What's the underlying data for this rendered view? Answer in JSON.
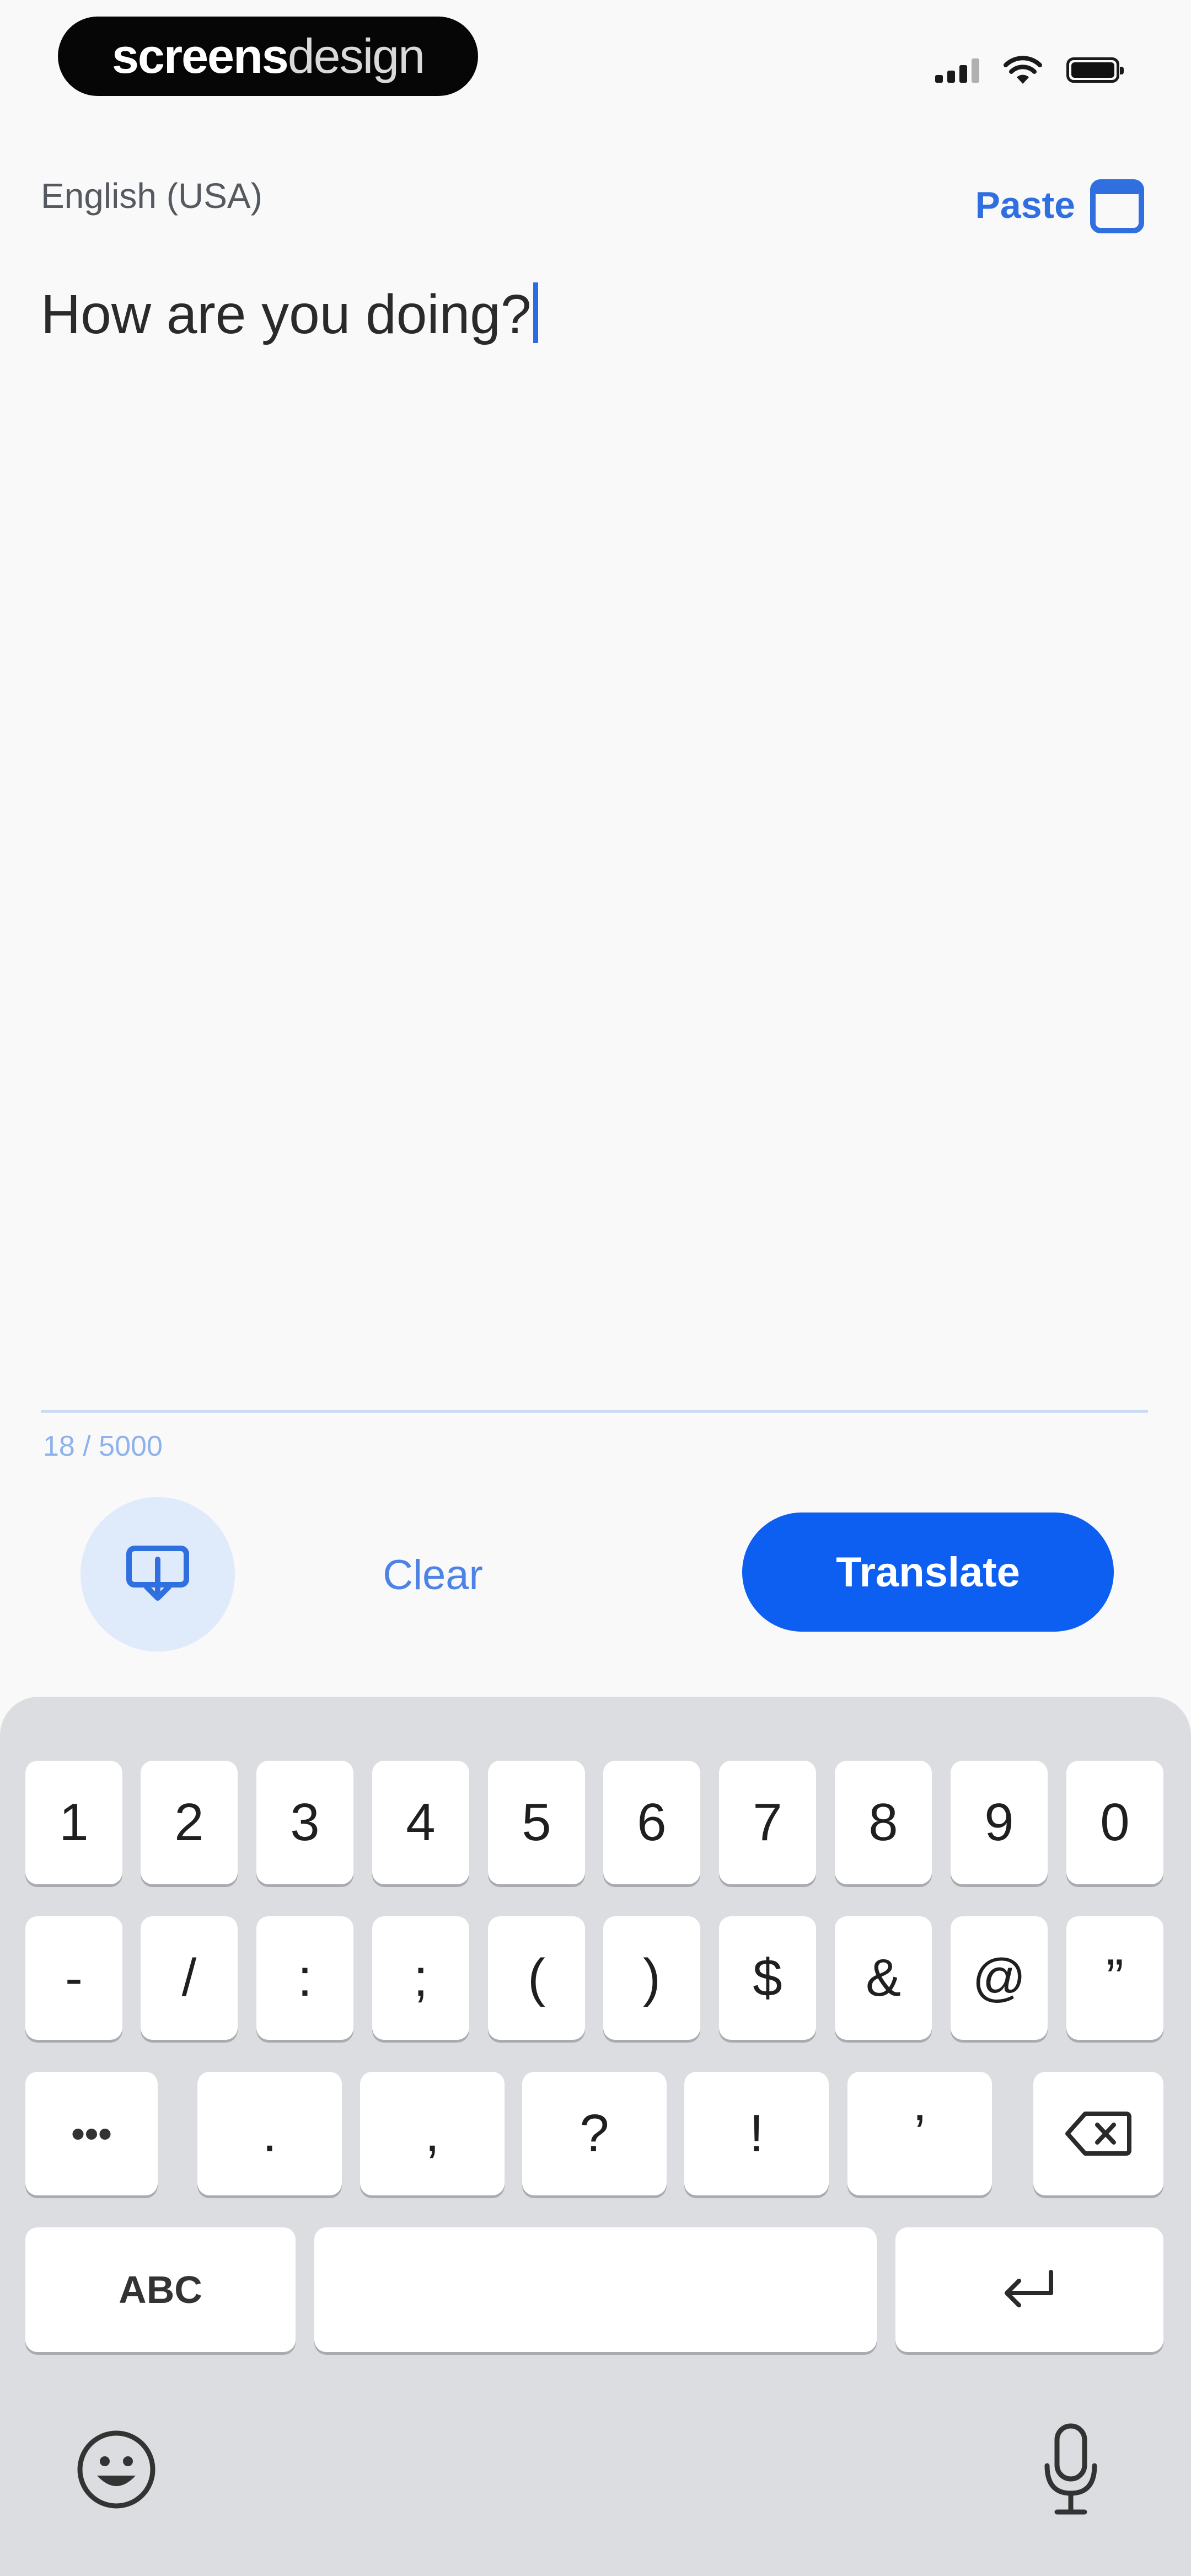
{
  "status_bar": {
    "watermark_bold": "screens",
    "watermark_light": "design"
  },
  "editor": {
    "source_language": "English (USA)",
    "paste_label": "Paste",
    "input_text": "How are you doing?",
    "char_count": "18 / 5000"
  },
  "actions": {
    "clear_label": "Clear",
    "translate_label": "Translate"
  },
  "keyboard": {
    "row1": [
      "1",
      "2",
      "3",
      "4",
      "5",
      "6",
      "7",
      "8",
      "9",
      "0"
    ],
    "row2": [
      "-",
      "/",
      ":",
      ";",
      "(",
      ")",
      "$",
      "&",
      "@",
      "”"
    ],
    "row3": [
      ".",
      ",",
      "?",
      "!",
      "’"
    ],
    "more_key": "•••",
    "abc_label": "ABC",
    "space_label": ""
  },
  "colors": {
    "accent": "#0d5ff2",
    "link": "#2f6fe0",
    "background": "#f9f9fa",
    "keyboard_bg": "#dcdde0"
  }
}
